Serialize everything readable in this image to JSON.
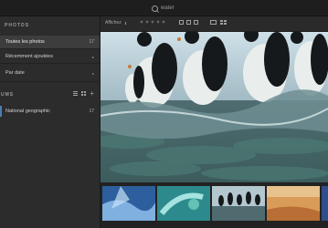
{
  "search": {
    "value": "water"
  },
  "sidebar": {
    "photos_header": "PHOTOS",
    "items": [
      {
        "label": "Toutes les photos",
        "count": "17"
      },
      {
        "label": "Récemment ajoutées"
      },
      {
        "label": "Par date"
      }
    ],
    "albums_header": "UMS",
    "albums": [
      {
        "label": "National geographic",
        "count": "17"
      }
    ]
  },
  "toolbar": {
    "sort_label": "Affichez"
  },
  "colors": {
    "sidebar_bg": "#2c2c2c",
    "active_item": "#3d3d3d",
    "accent": "#4a7fb5"
  }
}
